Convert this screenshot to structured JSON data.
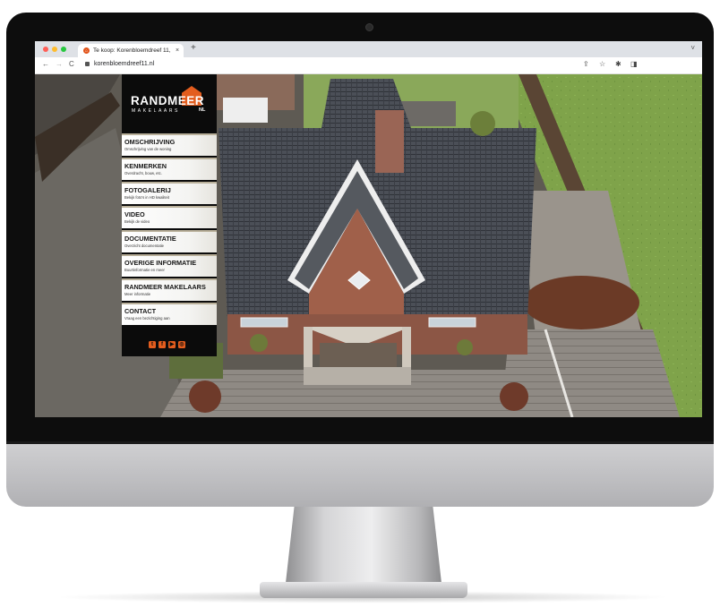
{
  "browser": {
    "tab_title": "Te koop: Korenbloemdreef 11,  ×",
    "tab_title_text": "Te koop: Korenbloemdreef 11, …",
    "tab_close": "×",
    "new_tab": "+",
    "url": "korenbloemdreef11.nl",
    "back": "←",
    "forward": "→",
    "reload": "C",
    "tabs_menu": "˅"
  },
  "logo": {
    "name": "RANDMEER",
    "sub": "MAKELAARS",
    "suffix": "NL"
  },
  "menu": [
    {
      "title": "OMSCHRIJVING",
      "subtitle": "Omschrijving van de woning"
    },
    {
      "title": "KENMERKEN",
      "subtitle": "Overdracht, bouw, etc."
    },
    {
      "title": "FOTOGALERIJ",
      "subtitle": "Bekijk foto's in HD kwaliteit"
    },
    {
      "title": "VIDEO",
      "subtitle": "Bekijk de video"
    },
    {
      "title": "DOCUMENTATIE",
      "subtitle": "Overzicht documentatie"
    },
    {
      "title": "OVERIGE INFORMATIE",
      "subtitle": "Buurtinformatie en meer"
    },
    {
      "title": "RANDMEER MAKELAARS",
      "subtitle": "Meer informatie"
    },
    {
      "title": "CONTACT",
      "subtitle": "Vraag een bezichtiging aan"
    }
  ],
  "socials": [
    "twitter-icon",
    "facebook-icon",
    "youtube-icon",
    "instagram-icon"
  ],
  "colors": {
    "accent": "#e35d1e",
    "sidebar": "#0b0b0b",
    "tabbar": "#dee1e6"
  }
}
